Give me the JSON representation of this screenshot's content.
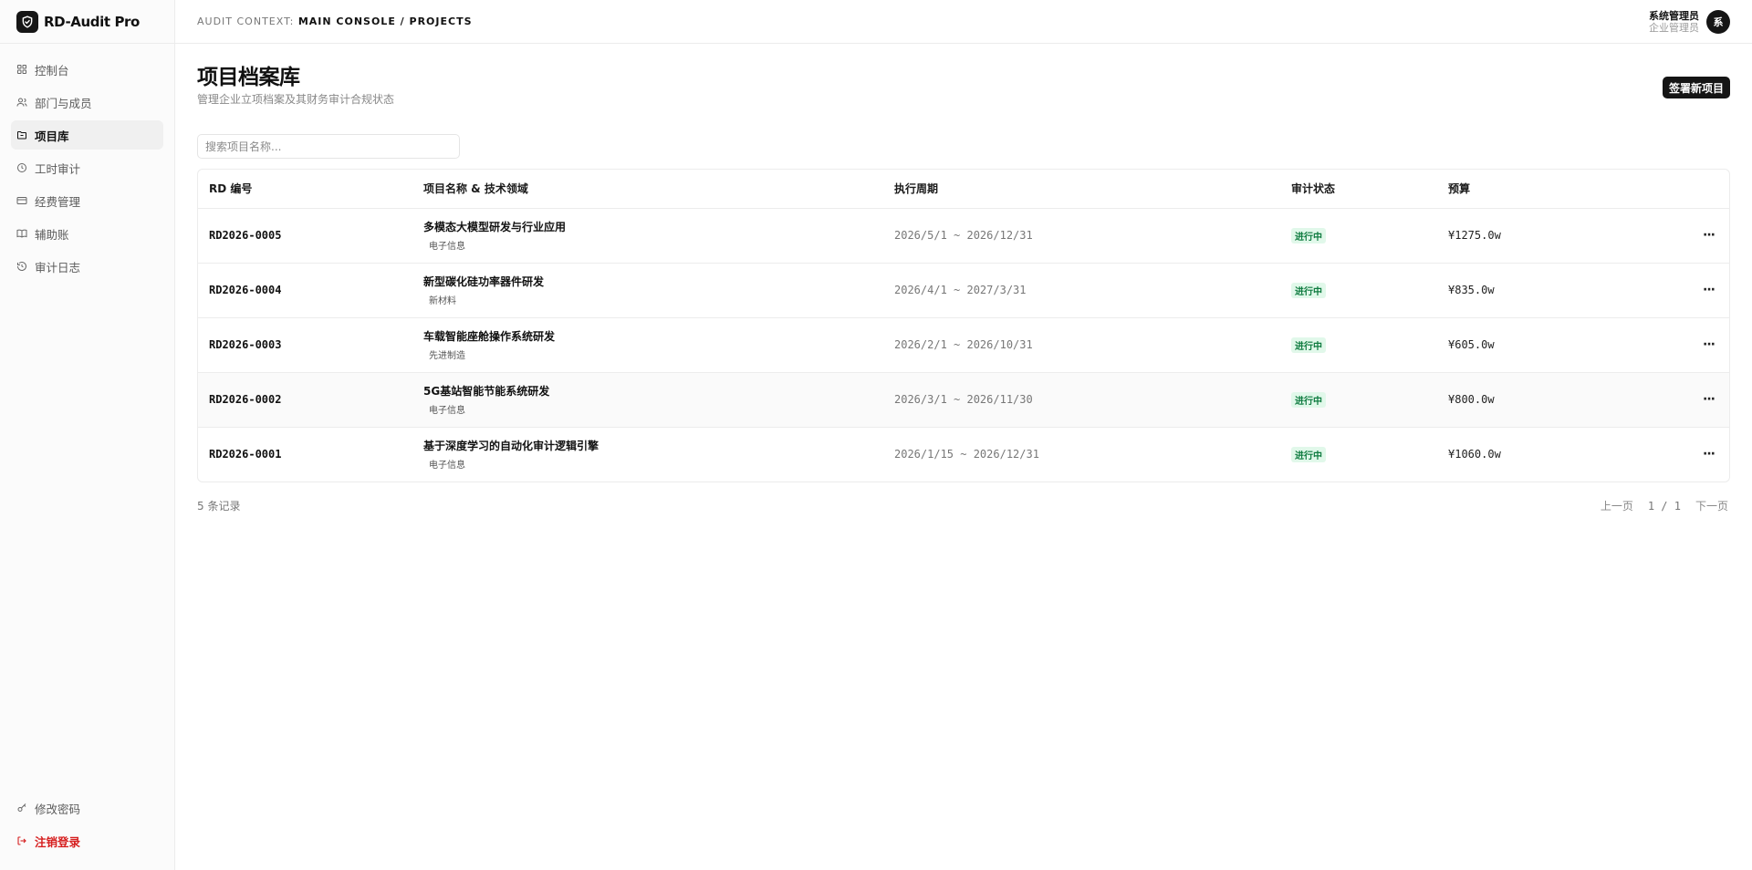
{
  "brand": {
    "name": "RD-Audit Pro",
    "logo_icon": "shield-check-icon"
  },
  "sidebar": {
    "items": [
      {
        "label": "控制台",
        "icon": "dashboard-icon",
        "active": false
      },
      {
        "label": "部门与成员",
        "icon": "users-icon",
        "active": false
      },
      {
        "label": "项目库",
        "icon": "folder-icon",
        "active": true
      },
      {
        "label": "工时审计",
        "icon": "clock-icon",
        "active": false
      },
      {
        "label": "经费管理",
        "icon": "credit-card-icon",
        "active": false
      },
      {
        "label": "辅助账",
        "icon": "book-icon",
        "active": false
      },
      {
        "label": "审计日志",
        "icon": "history-icon",
        "active": false
      }
    ],
    "bottom": [
      {
        "label": "修改密码",
        "icon": "key-icon"
      },
      {
        "label": "注销登录",
        "icon": "logout-icon"
      }
    ]
  },
  "topbar": {
    "context_label": "AUDIT CONTEXT:",
    "context_path": "MAIN CONSOLE / PROJECTS",
    "user_name": "系统管理员",
    "user_role": "企业管理员",
    "avatar_text": "系"
  },
  "page": {
    "title": "项目档案库",
    "subtitle": "管理企业立项档案及其财务审计合规状态",
    "new_button": "签署新项目",
    "search_placeholder": "搜索项目名称..."
  },
  "table": {
    "headers": [
      "RD 编号",
      "项目名称 & 技术领域",
      "执行周期",
      "审计状态",
      "预算"
    ],
    "rows": [
      {
        "id": "RD2026-0005",
        "name": "多模态大模型研发与行业应用",
        "field": "电子信息",
        "period": "2026/5/1 ~ 2026/12/31",
        "status": "进行中",
        "budget": "¥1275.0w",
        "action": "···"
      },
      {
        "id": "RD2026-0004",
        "name": "新型碳化硅功率器件研发",
        "field": "新材料",
        "period": "2026/4/1 ~ 2027/3/31",
        "status": "进行中",
        "budget": "¥835.0w",
        "action": "···"
      },
      {
        "id": "RD2026-0003",
        "name": "车载智能座舱操作系统研发",
        "field": "先进制造",
        "period": "2026/2/1 ~ 2026/10/31",
        "status": "进行中",
        "budget": "¥605.0w",
        "action": "···"
      },
      {
        "id": "RD2026-0002",
        "name": "5G基站智能节能系统研发",
        "field": "电子信息",
        "period": "2026/3/1 ~ 2026/11/30",
        "status": "进行中",
        "budget": "¥800.0w",
        "action": "···"
      },
      {
        "id": "RD2026-0001",
        "name": "基于深度学习的自动化审计逻辑引擎",
        "field": "电子信息",
        "period": "2026/1/15 ~ 2026/12/31",
        "status": "进行中",
        "budget": "¥1060.0w",
        "action": "···"
      }
    ]
  },
  "footer": {
    "record_count": "5 条记录",
    "prev": "上一页",
    "page_indicator": "1 / 1",
    "next": "下一页"
  },
  "colors": {
    "accent": "#151515",
    "status_bg": "#e1f8ea",
    "status_fg": "#0d7a3e",
    "danger": "#d61f1f"
  }
}
